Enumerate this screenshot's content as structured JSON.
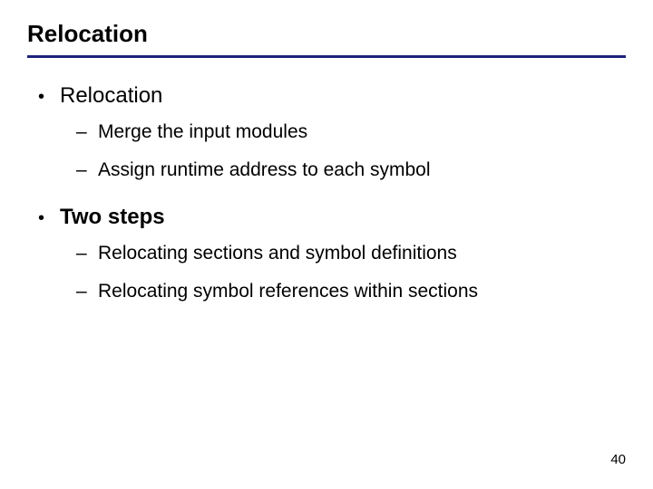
{
  "title": "Relocation",
  "bullets": [
    {
      "label": "Relocation",
      "bold": false,
      "sub": [
        "Merge the input modules",
        "Assign runtime address to each symbol"
      ]
    },
    {
      "label": "Two steps",
      "bold": true,
      "sub": [
        "Relocating sections and symbol definitions",
        "Relocating symbol references within sections"
      ]
    }
  ],
  "page_number": "40"
}
